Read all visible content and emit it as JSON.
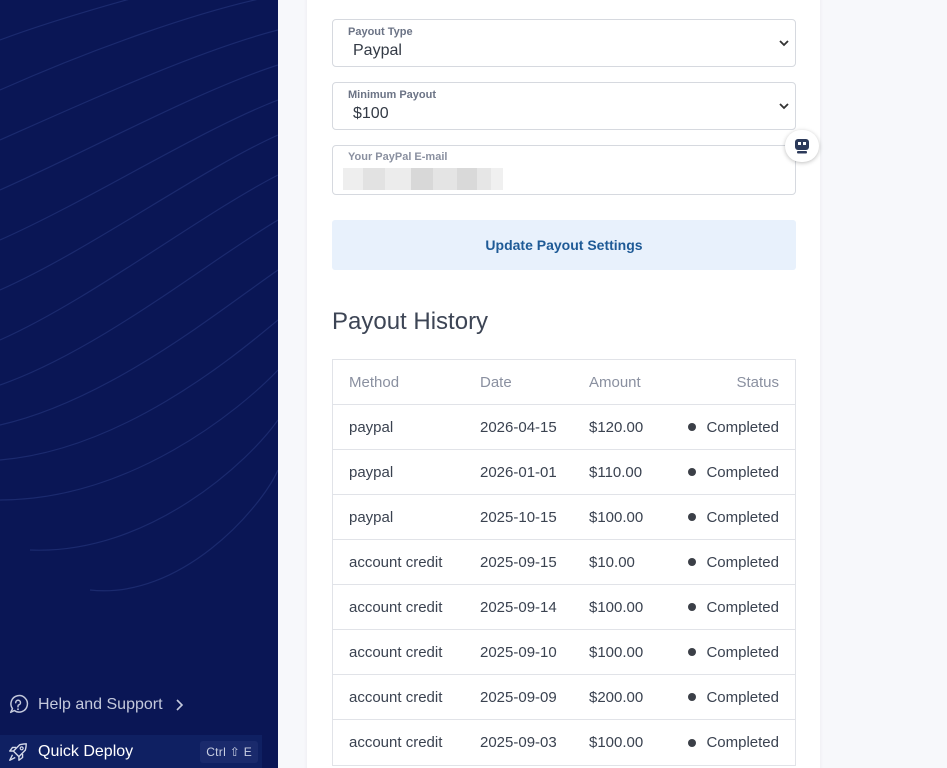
{
  "sidebar": {
    "help_label": "Help and Support",
    "deploy_label": "Quick Deploy",
    "deploy_shortcut": "Ctrl ⇧ E"
  },
  "form": {
    "payout_type": {
      "label": "Payout Type",
      "value": "Paypal"
    },
    "minimum_payout": {
      "label": "Minimum Payout",
      "value": "$100"
    },
    "paypal_email": {
      "label": "Your PayPal E-mail"
    },
    "update_button": "Update Payout Settings"
  },
  "history": {
    "title": "Payout History",
    "columns": {
      "method": "Method",
      "date": "Date",
      "amount": "Amount",
      "status": "Status"
    },
    "rows": [
      {
        "method": "paypal",
        "date": "2026-04-15",
        "amount": "$120.00",
        "status": "Completed"
      },
      {
        "method": "paypal",
        "date": "2026-01-01",
        "amount": "$110.00",
        "status": "Completed"
      },
      {
        "method": "paypal",
        "date": "2025-10-15",
        "amount": "$100.00",
        "status": "Completed"
      },
      {
        "method": "account credit",
        "date": "2025-09-15",
        "amount": "$10.00",
        "status": "Completed"
      },
      {
        "method": "account credit",
        "date": "2025-09-14",
        "amount": "$100.00",
        "status": "Completed"
      },
      {
        "method": "account credit",
        "date": "2025-09-10",
        "amount": "$100.00",
        "status": "Completed"
      },
      {
        "method": "account credit",
        "date": "2025-09-09",
        "amount": "$200.00",
        "status": "Completed"
      },
      {
        "method": "account credit",
        "date": "2025-09-03",
        "amount": "$100.00",
        "status": "Completed"
      }
    ]
  },
  "icons": {
    "help": "help-circle-icon",
    "deploy": "rocket-icon",
    "assistant": "robot-icon"
  },
  "colors": {
    "sidebar_bg": "#0a1655",
    "button_bg": "#e8f1fc",
    "button_text": "#1e5a96"
  }
}
